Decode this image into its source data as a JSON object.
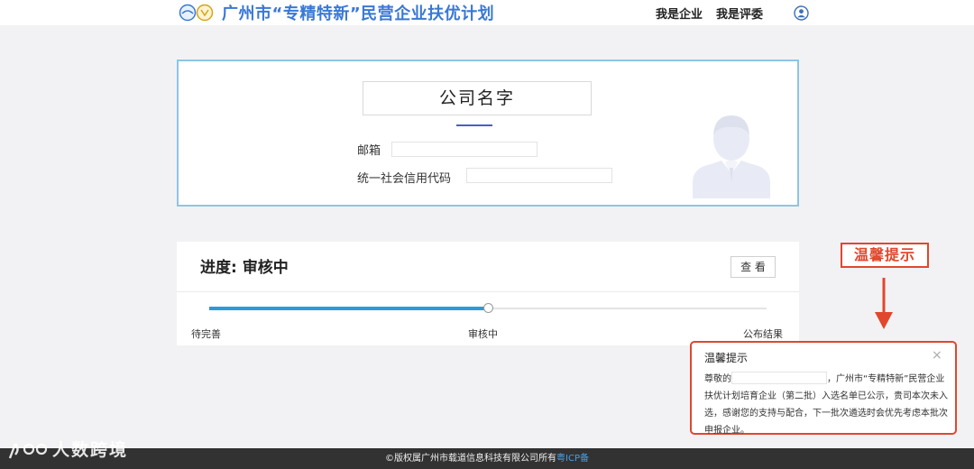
{
  "header": {
    "title": "广州市“专精特新”民营企业扶优计划",
    "nav": [
      "我是企业",
      "我是评委"
    ],
    "user_icon": "user-circle-icon"
  },
  "company": {
    "name": "公司名字",
    "email_label": "邮箱",
    "credit_code_label": "统一社会信用代码",
    "avatar_icon": "person-avatar-icon"
  },
  "progress": {
    "title": "进度: 审核中",
    "view_button": "查 看",
    "steps": [
      "待完善",
      "审核中",
      "公布结果"
    ],
    "current_step": 1,
    "progress_fraction": 0.5,
    "fill_color": "#2a9bd8"
  },
  "annotation": {
    "label": "温馨提示",
    "color": "#e0472d"
  },
  "notice": {
    "title": "温馨提示",
    "close_icon": "close-icon",
    "greeting": "尊敬的",
    "body": "，广州市“专精特新”民营企业扶优计划培育企业（第二批）入选名单已公示，贵司本次未入选，感谢您的支持与配合，下一批次遴选时会优先考虑本批次申报企业。"
  },
  "footer": {
    "copyright": "©版权属广州市载道信息科技有限公司所有",
    "icp": "粤ICP备"
  },
  "watermark": {
    "text": "人数跨境"
  }
}
